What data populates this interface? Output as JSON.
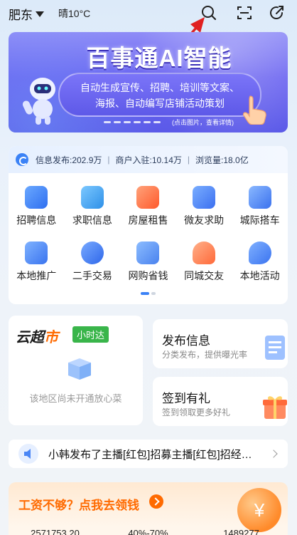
{
  "header": {
    "city": "肥东",
    "weather": "晴10°C"
  },
  "banner": {
    "title": "百事通AI智能",
    "line1": "自动生成宣传、招聘、培训等文案、",
    "line2": "海报、自动编写店铺活动策划",
    "hint": "(点击图片，查看详情)"
  },
  "stats": {
    "posts": "信息发布:202.9万",
    "merchants": "商户入驻:10.14万",
    "views": "浏览量:18.0亿"
  },
  "services": [
    {
      "label": "招聘信息",
      "icon": "recruit-icon",
      "color": "#3b7cf5"
    },
    {
      "label": "求职信息",
      "icon": "briefcase-icon",
      "color": "#3aa0f0"
    },
    {
      "label": "房屋租售",
      "icon": "house-door-icon",
      "color": "#ff6a3d"
    },
    {
      "label": "微友求助",
      "icon": "help-chat-icon",
      "color": "#3b7cf5"
    },
    {
      "label": "城际搭车",
      "icon": "car-icon",
      "color": "#3b7cf5"
    },
    {
      "label": "本地推广",
      "icon": "megaphone-icon",
      "color": "#3b7cf5"
    },
    {
      "label": "二手交易",
      "icon": "exchange-icon",
      "color": "#3b7cf5"
    },
    {
      "label": "网购省钱",
      "icon": "coupon-icon",
      "color": "#4a8cf0"
    },
    {
      "label": "同城交友",
      "icon": "heart-icon",
      "color": "#ff7a4a"
    },
    {
      "label": "本地活动",
      "icon": "location-pin-icon",
      "color": "#3b7cf5"
    }
  ],
  "market": {
    "title_a": "云超",
    "title_b": "市",
    "tag": "小时达",
    "empty": "该地区尚未开通放心菜"
  },
  "publish": {
    "title": "发布信息",
    "subtitle": "分类发布，提供曝光率"
  },
  "checkin": {
    "title": "签到有礼",
    "subtitle": "签到领取更多好礼"
  },
  "notice": {
    "text": "小韩发布了主播[红包]招募主播[红包]招经…"
  },
  "promo": {
    "title": "工资不够？点我去领钱",
    "coin_symbol": "¥",
    "num1": "2571753.20",
    "num2": "40%-70%",
    "num3": "1489277"
  }
}
